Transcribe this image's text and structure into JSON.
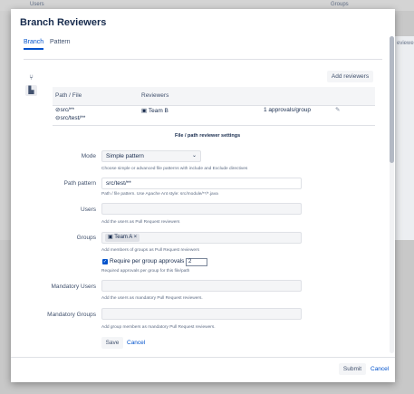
{
  "background": {
    "col_users": "Users",
    "col_groups": "Groups",
    "right_fragment": "eviewe"
  },
  "modal": {
    "title": "Branch Reviewers",
    "tabs": [
      {
        "label": "Branch",
        "active": true
      },
      {
        "label": "Pattern",
        "active": false
      }
    ],
    "side_icons": [
      "branch-icon",
      "building-icon"
    ],
    "add_reviewers_label": "Add reviewers",
    "table": {
      "headers": [
        "Path / File",
        "Reviewers"
      ],
      "row": {
        "paths": [
          "src/**",
          "src/test/**"
        ],
        "reviewer": "Team B",
        "approvals": "1 approvals/group"
      }
    },
    "section_title": "File / path reviewer settings",
    "form": {
      "mode_label": "Mode",
      "mode_value": "Simple pattern",
      "mode_help": "Choose simple or advanced file patterns with include and Exclude directives",
      "path_label": "Path pattern",
      "path_value": "src/test/**",
      "path_help": "Path / file pattern. Use Apache Ant style: src/module/**/*.java",
      "users_label": "Users",
      "users_help": "Add the users as Pull Request reviewers",
      "groups_label": "Groups",
      "groups_tag": "Team A",
      "groups_help": "Add members of groups as Pull Request reviewers",
      "require_label": "Require per group approvals",
      "require_checked": true,
      "require_value": "2",
      "require_help": "Required approvals per group for this file/path",
      "mandatory_users_label": "Mandatory Users",
      "mandatory_users_help": "Add the users as mandatory Pull Request reviewers.",
      "mandatory_groups_label": "Mandatory Groups",
      "mandatory_groups_help": "Add group members as mandatory Pull Request reviewers.",
      "save_label": "Save",
      "cancel_label": "Cancel"
    },
    "footer": {
      "submit_label": "Submit",
      "cancel_label": "Cancel"
    }
  }
}
